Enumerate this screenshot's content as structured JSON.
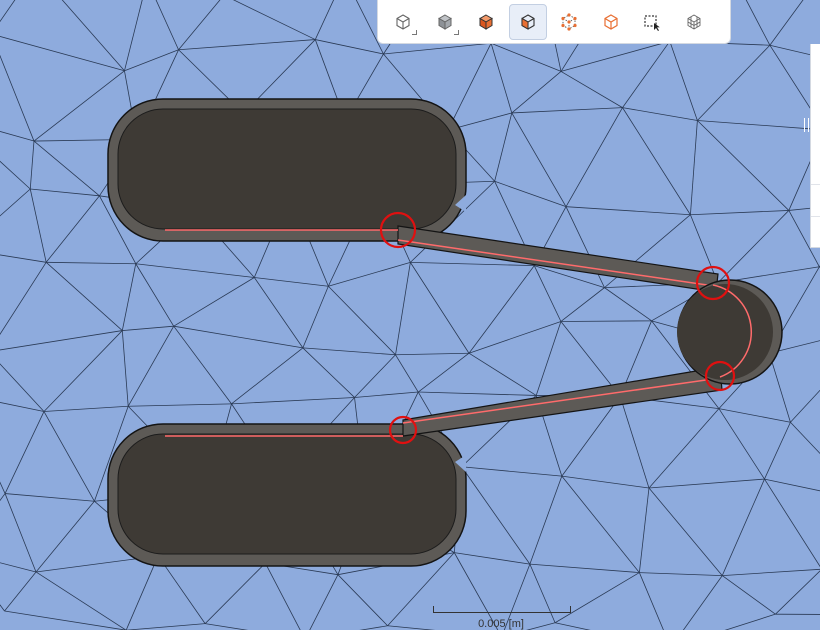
{
  "viewport": {
    "background_color": "#8eabdd",
    "mesh_color": "#2a3a55",
    "solid_color": "#3e3a35",
    "outline_color": "#141414",
    "highlight_edge_color": "#ff6b6b",
    "marker_color": "#e01010"
  },
  "toolbar": {
    "buttons": [
      {
        "name": "wireframe-cube-icon",
        "active": false,
        "has_dropdown": true
      },
      {
        "name": "shaded-cube-icon",
        "active": false,
        "has_dropdown": true
      },
      {
        "name": "select-body-icon",
        "active": false,
        "has_dropdown": false
      },
      {
        "name": "select-face-icon",
        "active": true,
        "has_dropdown": false
      },
      {
        "name": "select-vertex-icon",
        "active": false,
        "has_dropdown": false
      },
      {
        "name": "select-edge-icon",
        "active": false,
        "has_dropdown": false
      },
      {
        "name": "box-select-icon",
        "active": false,
        "has_dropdown": false
      },
      {
        "name": "mesh-select-icon",
        "active": false,
        "has_dropdown": false
      }
    ]
  },
  "scale_bar": {
    "label": "0.005 [m]"
  }
}
